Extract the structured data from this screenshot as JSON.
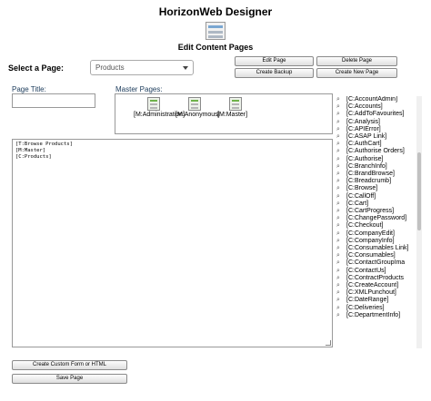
{
  "app": {
    "title": "HorizonWeb Designer",
    "page_heading": "Edit Content Pages"
  },
  "page_select": {
    "label": "Select a Page:",
    "value": "Products"
  },
  "toolbar": {
    "edit_page": "Edit Page",
    "delete_page": "Delete Page",
    "create_backup": "Create Backup",
    "create_new_page": "Create New Page"
  },
  "page_title": {
    "label": "Page Title:",
    "value": ""
  },
  "master_pages": {
    "label": "Master Pages:",
    "items": [
      {
        "name": "[M:Administration]"
      },
      {
        "name": "[M:Anonymous]"
      },
      {
        "name": "[M:Master]"
      }
    ]
  },
  "editor": {
    "lines": [
      "[T:Browse Products]",
      "[M:Master]",
      "[C:Products]"
    ]
  },
  "components": {
    "icon": "magnifier-icon",
    "items": [
      "[C:AccountAdmin]",
      "[C:Accounts]",
      "[C:AddToFavourites]",
      "[C:Analysis]",
      "[C:APIError]",
      "[C:ASAP Link]",
      "[C:AuthCart]",
      "[C:Authorise Orders]",
      "[C:Authorise]",
      "[C:BranchInfo]",
      "[C:BrandBrowse]",
      "[C:Breadcrumb]",
      "[C:Browse]",
      "[C:CallOff]",
      "[C:Cart]",
      "[C:CartProgress]",
      "[C:ChangePassword]",
      "[C:Checkout]",
      "[C:CompanyEdit]",
      "[C:CompanyInfo]",
      "[C:Consumables Link]",
      "[C:Consumables]",
      "[C:ContactGroupIma",
      "[C:ContactUs]",
      "[C:ContractProducts",
      "[C:CreateAccount]",
      "[C:XMLPunchout]",
      "[C:DateRange]",
      "[C:Deliveries]",
      "[C:DepartmentInfo]"
    ]
  },
  "footer": {
    "create_custom": "Create Custom Form or HTML",
    "save_page": "Save Page"
  }
}
